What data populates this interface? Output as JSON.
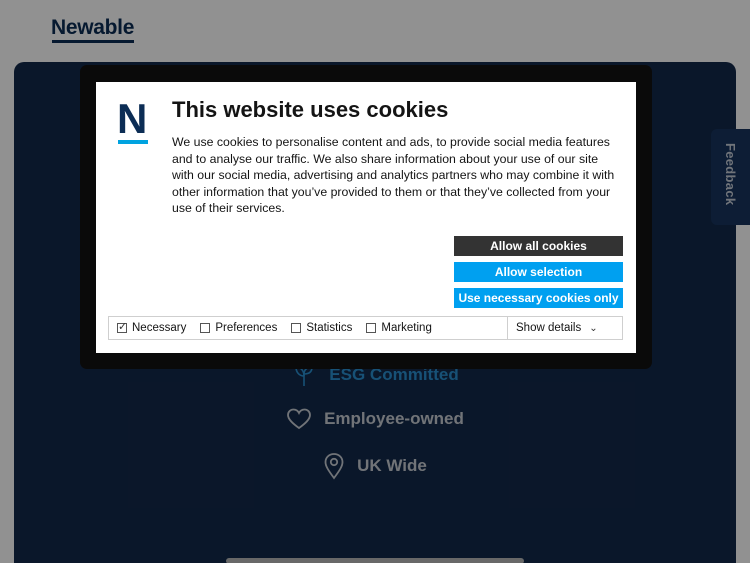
{
  "header": {
    "logo_text": "Newable"
  },
  "feedback": {
    "label": "Feedback"
  },
  "features": [
    {
      "label": "ESG Committed",
      "icon": "plant-icon"
    },
    {
      "label": "Employee-owned",
      "icon": "heart-icon"
    },
    {
      "label": "UK Wide",
      "icon": "location-pin-icon"
    }
  ],
  "cookie_dialog": {
    "brand_letter": "N",
    "title": "This website uses cookies",
    "body": "We use cookies to personalise content and ads, to provide social media features and to analyse our traffic. We also share information about your use of our site with our social media, advertising and analytics partners who may combine it with other information that you’ve provided to them or that they’ve collected from your use of their services.",
    "buttons": {
      "allow_all": "Allow all cookies",
      "allow_selection": "Allow selection",
      "necessary_only": "Use necessary cookies only"
    },
    "checkboxes": [
      {
        "label": "Necessary",
        "checked": true
      },
      {
        "label": "Preferences",
        "checked": false
      },
      {
        "label": "Statistics",
        "checked": false
      },
      {
        "label": "Marketing",
        "checked": false
      }
    ],
    "show_details": "Show details"
  },
  "colors": {
    "brand_navy": "#0c2d55",
    "hero_bg": "#13294a",
    "accent_blue": "#00a0f0",
    "dark_button": "#333333",
    "esg_blue": "#2a8fd0"
  }
}
